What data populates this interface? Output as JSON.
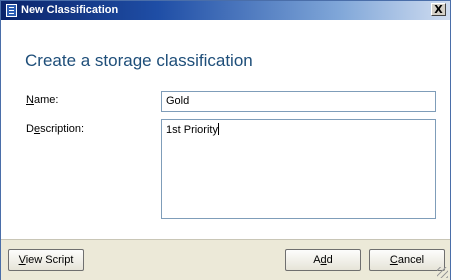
{
  "window": {
    "title": "New Classification",
    "close_label": "X"
  },
  "heading": "Create a storage classification",
  "form": {
    "name_label": "Name:",
    "name_value": "Gold",
    "description_label": "Description:",
    "description_value": "1st Priority"
  },
  "buttons": {
    "view_script": "View Script",
    "add": "Add",
    "cancel": "Cancel"
  },
  "icons": [
    "window-app-icon",
    "close-icon",
    "resize-grip-icon"
  ]
}
